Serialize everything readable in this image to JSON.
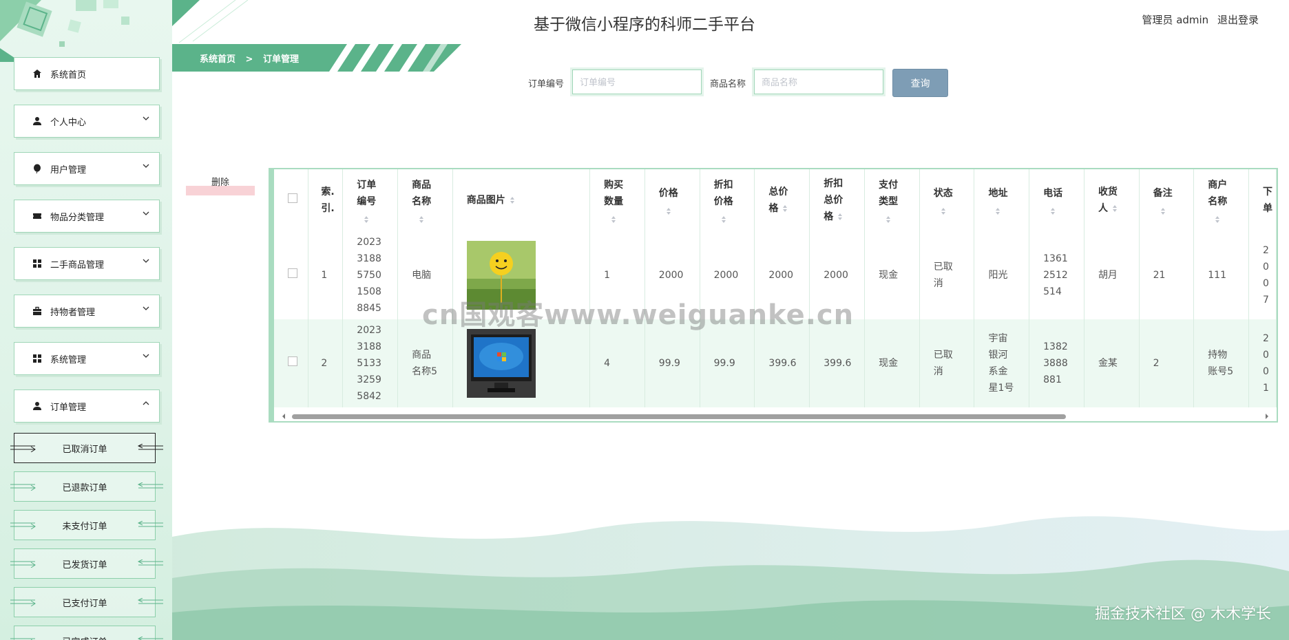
{
  "app": {
    "title": "基于微信小程序的科师二手平台",
    "user_label": "管理员 admin",
    "logout_label": "退出登录"
  },
  "breadcrumb": {
    "home": "系统首页",
    "separator": ">",
    "current": "订单管理"
  },
  "sidebar": {
    "items": [
      {
        "label": "系统首页",
        "icon": "home-icon"
      },
      {
        "label": "个人中心",
        "icon": "user-icon"
      },
      {
        "label": "用户管理",
        "icon": "balloon-icon"
      },
      {
        "label": "物品分类管理",
        "icon": "ticket-icon"
      },
      {
        "label": "二手商品管理",
        "icon": "grid-icon"
      },
      {
        "label": "持物者管理",
        "icon": "briefcase-icon"
      },
      {
        "label": "系统管理",
        "icon": "grid-icon"
      },
      {
        "label": "订单管理",
        "icon": "user-icon"
      }
    ],
    "sub_items": [
      {
        "label": "已取消订单"
      },
      {
        "label": "已退款订单"
      },
      {
        "label": "未支付订单"
      },
      {
        "label": "已发货订单"
      },
      {
        "label": "已支付订单"
      },
      {
        "label": "已完成订单"
      }
    ]
  },
  "search": {
    "order_no_label": "订单编号",
    "order_no_placeholder": "订单编号",
    "goods_name_label": "商品名称",
    "goods_name_placeholder": "商品名称",
    "query_label": "查询"
  },
  "actions": {
    "delete_label": "删除"
  },
  "table": {
    "headers": [
      "索.\n引.",
      "订单\n编号",
      "商品\n名称",
      "商品图片",
      "购买\n数量",
      "价格",
      "折扣\n价格",
      "总价\n格",
      "折扣\n总价\n格",
      "支付\n类型",
      "状态",
      "地址",
      "电话",
      "收货\n人",
      "备注",
      "商户\n名称",
      "下\n单"
    ],
    "rows": [
      {
        "index": "1",
        "order_no": "2023\n3188\n5750\n1508\n8845",
        "goods_name": "电脑",
        "image": "smiley-balloon",
        "qty": "1",
        "price": "2000",
        "discount_price": "2000",
        "total": "2000",
        "discount_total": "2000",
        "pay_type": "现金",
        "status": "已取\n消",
        "address": "阳光",
        "phone": "1361\n2512\n514",
        "receiver": "胡月",
        "note": "21",
        "merchant": "111",
        "time": "2\n0\n0\n7"
      },
      {
        "index": "2",
        "order_no": "2023\n3188\n5133\n3259\n5842",
        "goods_name": "商品\n名称5",
        "image": "windows-monitor",
        "qty": "4",
        "price": "99.9",
        "discount_price": "99.9",
        "total": "399.6",
        "discount_total": "399.6",
        "pay_type": "现金",
        "status": "已取\n消",
        "address": "宇宙\n银河\n系金\n星1号",
        "phone": "1382\n3888\n881",
        "receiver": "金某",
        "note": "2",
        "merchant": "持物\n账号5",
        "time": "2\n0\n0\n1"
      }
    ]
  },
  "watermark": "cn国观客www.weiguanke.cn",
  "footer": {
    "credit": "掘金技术社区 @ 木木学长"
  },
  "colors": {
    "accent": "#5bb38a",
    "sidebar_bg": "#e3f5eb",
    "query_button": "#7e9db5",
    "delete_highlight": "#f8d2d6"
  }
}
